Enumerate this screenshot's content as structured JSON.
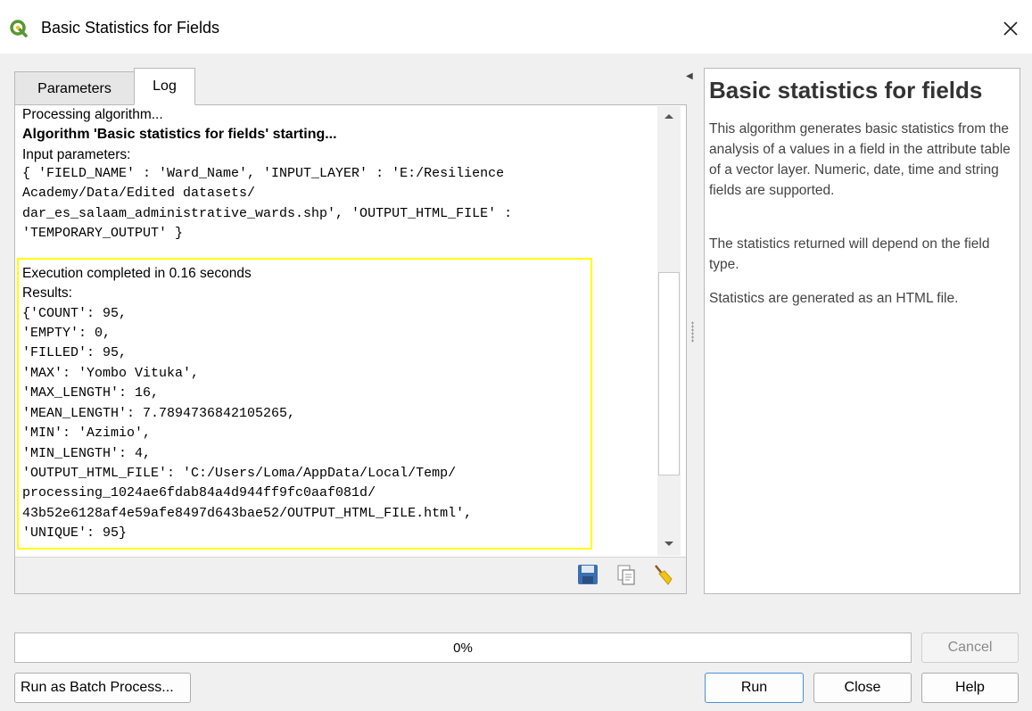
{
  "window": {
    "title": "Basic Statistics for Fields",
    "icon": "qgis-logo-icon",
    "close_icon": "close-icon"
  },
  "tabs": [
    {
      "label": "Parameters",
      "active": false
    },
    {
      "label": "Log",
      "active": true
    }
  ],
  "log": {
    "processing": "Processing algorithm...",
    "starting": "Algorithm 'Basic statistics for fields' starting...",
    "input_params_label": "Input parameters:",
    "input_params": [
      "{ 'FIELD_NAME' : 'Ward_Name', 'INPUT_LAYER' : 'E:/Resilience",
      "Academy/Data/Edited datasets/",
      "dar_es_salaam_administrative_wards.shp', 'OUTPUT_HTML_FILE' :",
      "'TEMPORARY_OUTPUT' }"
    ],
    "execution": "Execution completed in 0.16 seconds",
    "results_label": "Results:",
    "results": [
      "{'COUNT': 95,",
      "'EMPTY': 0,",
      "'FILLED': 95,",
      "'MAX': 'Yombo Vituka',",
      "'MAX_LENGTH': 16,",
      "'MEAN_LENGTH': 7.7894736842105265,",
      "'MIN': 'Azimio',",
      "'MIN_LENGTH': 4,",
      "'OUTPUT_HTML_FILE': 'C:/Users/Loma/AppData/Local/Temp/",
      "processing_1024ae6fdab84a4d944ff9fc0aaf081d/",
      "43b52e6128af4e59afe8497d643bae52/OUTPUT_HTML_FILE.html',",
      "'UNIQUE': 95}"
    ],
    "highlight_color": "#ffff00"
  },
  "log_toolbar": [
    "save-log-icon",
    "copy-log-icon",
    "clear-log-icon"
  ],
  "help": {
    "title": "Basic statistics for fields",
    "paragraphs": [
      "This algorithm generates basic statistics from the analysis of a values in a field in the attribute table of a vector layer. Numeric, date, time and string fields are supported.",
      "The statistics returned will depend on the field type.",
      "Statistics are generated as an HTML file."
    ]
  },
  "progress": {
    "label": "0%",
    "value": 0
  },
  "buttons": {
    "cancel": "Cancel",
    "batch": "Run as Batch Process...",
    "run": "Run",
    "close": "Close",
    "help": "Help"
  },
  "colors": {
    "accent": "#4a90d9",
    "qgis_green": "#589632",
    "qgis_yellow": "#f0c31a"
  }
}
